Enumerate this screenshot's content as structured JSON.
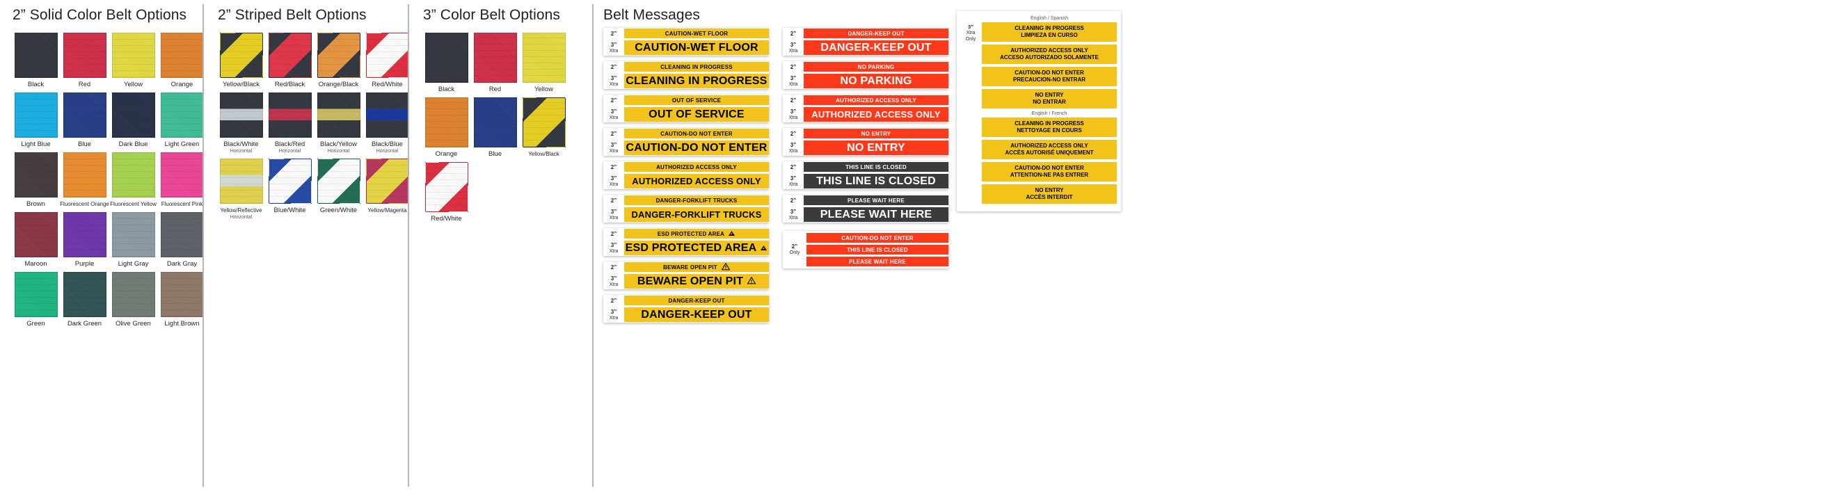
{
  "sections": {
    "solid": {
      "title": "2” Solid Color Belt Options",
      "swatches": [
        {
          "label": "Black",
          "color": "#2e333c"
        },
        {
          "label": "Red",
          "color": "#d02b45"
        },
        {
          "label": "Yellow",
          "color": "#e4dc3d"
        },
        {
          "label": "Orange",
          "color": "#e0812b"
        },
        {
          "label": "Light Blue",
          "color": "#16aee4"
        },
        {
          "label": "Blue",
          "color": "#223a86"
        },
        {
          "label": "Dark Blue",
          "color": "#242d44"
        },
        {
          "label": "Light Green",
          "color": "#3bbd96"
        },
        {
          "label": "Brown",
          "color": "#42383b"
        },
        {
          "label": "Fluorescent Orange",
          "color": "#ec8b2a"
        },
        {
          "label": "Fluorescent Yellow",
          "color": "#a6d44b"
        },
        {
          "label": "Fluorescent Pink",
          "color": "#ef4296"
        },
        {
          "label": "Maroon",
          "color": "#8a3242"
        },
        {
          "label": "Purple",
          "color": "#6b33ab"
        },
        {
          "label": "Light Gray",
          "color": "#8b9aa4"
        },
        {
          "label": "Dark Gray",
          "color": "#5b5f65"
        },
        {
          "label": "Green",
          "color": "#18b67f"
        },
        {
          "label": "Dark Green",
          "color": "#2d5052"
        },
        {
          "label": "Olive Green",
          "color": "#6f7a72"
        },
        {
          "label": "Light Brown",
          "color": "#8e7566"
        }
      ]
    },
    "striped": {
      "title": "2” Striped Belt Options",
      "swatches": [
        {
          "label": "Yellow/Black",
          "sublabel": "",
          "style": "diag",
          "c1": "#e9d01c",
          "c2": "#2e333c"
        },
        {
          "label": "Red/Black",
          "sublabel": "",
          "style": "diag",
          "c1": "#e23145",
          "c2": "#2e333c"
        },
        {
          "label": "Orange/Black",
          "sublabel": "",
          "style": "diag",
          "c1": "#e8943d",
          "c2": "#2e333c"
        },
        {
          "label": "Red/White",
          "sublabel": "",
          "style": "diag",
          "c1": "#ffffff",
          "c2": "#e02a3c"
        },
        {
          "label": "Black/White",
          "sublabel": "Horizontal",
          "style": "horiz",
          "c1": "#2e333c",
          "c2": "#c4ccd3"
        },
        {
          "label": "Black/Red",
          "sublabel": "Horizontal",
          "style": "horiz",
          "c1": "#2e333c",
          "c2": "#c03048"
        },
        {
          "label": "Black/Yellow",
          "sublabel": "Horizontal",
          "style": "horiz",
          "c1": "#2e333c",
          "c2": "#c9bd5e"
        },
        {
          "label": "Black/Blue",
          "sublabel": "Horizontal",
          "style": "horiz",
          "c1": "#2e333c",
          "c2": "#14339b"
        },
        {
          "label": "Yellow/Reflective",
          "sublabel": "Horizontal",
          "style": "horiz",
          "c1": "#e3d44a",
          "c2": "#d7dbd5"
        },
        {
          "label": "Blue/White",
          "sublabel": "",
          "style": "diag",
          "c1": "#ffffff",
          "c2": "#1f47a5"
        },
        {
          "label": "Green/White",
          "sublabel": "",
          "style": "diag",
          "c1": "#ffffff",
          "c2": "#1d6a52"
        },
        {
          "label": "Yellow/Magenta",
          "sublabel": "",
          "style": "diag",
          "c1": "#e8d741",
          "c2": "#b8325c"
        }
      ]
    },
    "three_inch": {
      "title": "3” Color Belt Options",
      "swatches": [
        {
          "label": "Black",
          "style": "solid",
          "c1": "#2e333c"
        },
        {
          "label": "Red",
          "style": "solid",
          "c1": "#d02b45"
        },
        {
          "label": "Yellow",
          "style": "solid",
          "c1": "#e4dc3d"
        },
        {
          "label": "Orange",
          "style": "solid",
          "c1": "#e0812b"
        },
        {
          "label": "Blue",
          "style": "solid",
          "c1": "#223a86"
        },
        {
          "label": "Yellow/Black",
          "style": "diag",
          "c1": "#e9d01c",
          "c2": "#2e333c"
        },
        {
          "label": "Red/White",
          "style": "diag",
          "c1": "#ffffff",
          "c2": "#e02a3c"
        }
      ]
    },
    "messages": {
      "title": "Belt Messages",
      "size_2": "2”",
      "size_3": "3”",
      "size_3_sub": "Xtra",
      "size_2_only_sub": "Only",
      "size_3_only_sub": "Only",
      "yellow_groups": [
        {
          "text": "CAUTION-WET FLOOR"
        },
        {
          "text": "CLEANING IN PROGRESS"
        },
        {
          "text": "OUT OF SERVICE"
        },
        {
          "text": "CAUTION-DO NOT ENTER"
        },
        {
          "text": "AUTHORIZED ACCESS ONLY"
        },
        {
          "text": "DANGER-FORKLIFT TRUCKS"
        },
        {
          "text": "ESD PROTECTED AREA",
          "icon": "esd-icon"
        },
        {
          "text": "BEWARE OPEN PIT",
          "icon": "warning-triangle-icon"
        },
        {
          "text": "DANGER-KEEP OUT"
        }
      ],
      "red_groups": [
        {
          "text": "DANGER-KEEP OUT",
          "color": "red"
        },
        {
          "text": "NO PARKING",
          "color": "red"
        },
        {
          "text": "AUTHORIZED ACCESS ONLY",
          "color": "red"
        },
        {
          "text": "NO ENTRY",
          "color": "red"
        },
        {
          "text": "THIS LINE IS CLOSED",
          "color": "black"
        },
        {
          "text": "PLEASE WAIT HERE",
          "color": "black"
        }
      ],
      "two_inch_only": [
        "CAUTION-DO NOT ENTER",
        "THIS LINE IS CLOSED",
        "PLEASE WAIT HERE"
      ],
      "bilingual": {
        "header_spanish": "English / Spanish",
        "header_french": "English / French",
        "spanish": [
          {
            "line1": "CLEANING IN PROGRESS",
            "line2": "LIMPIEZA EN CURSO"
          },
          {
            "line1": "AUTHORIZED ACCESS ONLY",
            "line2": "ACCESO AUTORIZADO SOLAMENTE"
          },
          {
            "line1": "CAUTION-DO NOT ENTER",
            "line2": "PRECAUCION-NO ENTRAR"
          },
          {
            "line1": "NO ENTRY",
            "line2": "NO ENTRAR"
          }
        ],
        "french": [
          {
            "line1": "CLEANING IN PROGRESS",
            "line2": "NETTOYAGE EN COURS"
          },
          {
            "line1": "AUTHORIZED ACCESS ONLY",
            "line2": "ACCÈS AUTORISÉ UNIQUEMENT"
          },
          {
            "line1": "CAUTION-DO NOT ENTER",
            "line2": "ATTENTION-NE PAS ENTRER"
          },
          {
            "line1": "NO ENTRY",
            "line2": "ACCÈS INTERDIT"
          }
        ]
      }
    }
  },
  "colors": {
    "yellow": "#f2c31b",
    "red": "#fc3a1b",
    "black": "#3b3b3d"
  }
}
